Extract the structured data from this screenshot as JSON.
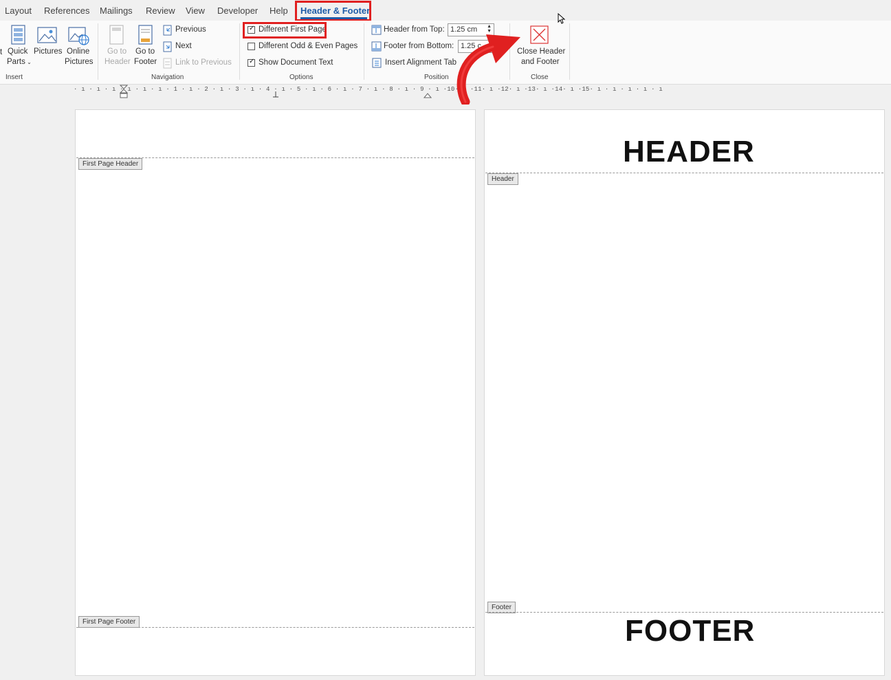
{
  "tabs": [
    {
      "label": "Layout"
    },
    {
      "label": "References"
    },
    {
      "label": "Mailings"
    },
    {
      "label": "Review"
    },
    {
      "label": "View"
    },
    {
      "label": "Developer"
    },
    {
      "label": "Help"
    },
    {
      "label": "Header & Footer",
      "active": true
    }
  ],
  "ribbon": {
    "insert": {
      "quick_parts_line1": "Quick",
      "quick_parts_line2": "Parts",
      "pictures": "Pictures",
      "online_pictures_line1": "Online",
      "online_pictures_line2": "Pictures",
      "group_label": "Insert"
    },
    "navigation": {
      "go_to_header_line1": "Go to",
      "go_to_header_line2": "Header",
      "go_to_footer_line1": "Go to",
      "go_to_footer_line2": "Footer",
      "previous": "Previous",
      "next": "Next",
      "link_to_previous": "Link to Previous",
      "group_label": "Navigation"
    },
    "options": {
      "different_first_page": "Different First Page",
      "different_first_page_checked": true,
      "different_odd_even": "Different Odd & Even Pages",
      "different_odd_even_checked": false,
      "show_document_text": "Show Document Text",
      "show_document_text_checked": true,
      "group_label": "Options"
    },
    "position": {
      "header_from_top_label": "Header from Top:",
      "header_from_top_value": "1.25 cm",
      "footer_from_bottom_label": "Footer from Bottom:",
      "footer_from_bottom_value": "1.25 c",
      "insert_alignment_tab": "Insert Alignment Tab",
      "group_label": "Position"
    },
    "close": {
      "close_line1": "Close Header",
      "close_line2": "and Footer",
      "group_label": "Close"
    }
  },
  "ruler": {
    "text": "· ı · ı · ı · ı · ı · ı · 1 · ı · 2 · ı · 3 · ı · 4 · ı · 5 · ı · 6 · ı · 7 · ı · 8 · ı · 9 · ı ·10· ı ·11· ı ·12· ı ·13· ı ·14· ı ·15· ı · ı · ı · ı · ı"
  },
  "page1": {
    "header_tag": "First Page Header",
    "footer_tag": "First Page Footer"
  },
  "page2": {
    "header_text": "HEADER",
    "header_tag": "Header",
    "footer_tag": "Footer",
    "footer_text": "FOOTER"
  },
  "colors": {
    "accent": "#1e5ba8",
    "highlight_red": "#e02020"
  }
}
